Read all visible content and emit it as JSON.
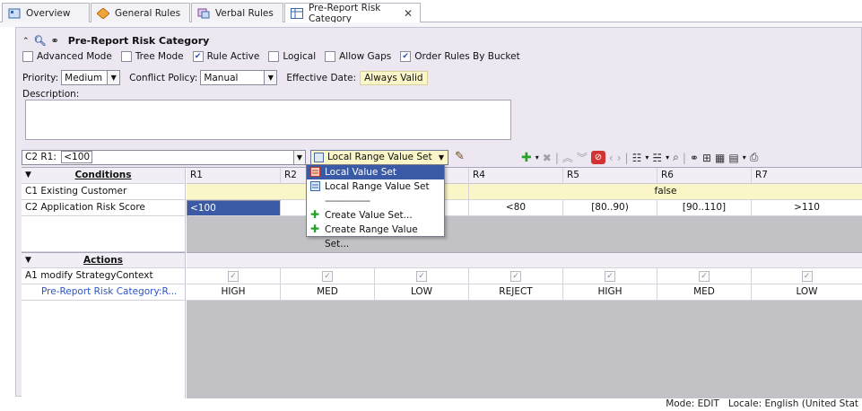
{
  "tabs": [
    {
      "label": "Overview",
      "icon": "overview-icon"
    },
    {
      "label": "General Rules",
      "icon": "rules-diamond-icon"
    },
    {
      "label": "Verbal Rules",
      "icon": "verbal-rules-icon"
    },
    {
      "label": "Pre-Report Risk Category",
      "icon": "decision-table-icon",
      "close": "✕"
    }
  ],
  "header": {
    "title": "Pre-Report Risk Category"
  },
  "options": {
    "advanced_mode": "Advanced Mode",
    "tree_mode": "Tree Mode",
    "rule_active": "Rule Active",
    "logical": "Logical",
    "allow_gaps": "Allow Gaps",
    "order_rules": "Order Rules By Bucket"
  },
  "fields": {
    "priority_label": "Priority:",
    "priority_value": "Medium",
    "conflict_label": "Conflict Policy:",
    "conflict_value": "Manual",
    "effective_label": "Effective Date:",
    "effective_value": "Always Valid",
    "description_label": "Description:"
  },
  "toolbar": {
    "cell_ref": "C2 R1:",
    "cell_value": "<100",
    "value_set_select": "Local Range Value Set"
  },
  "popup": {
    "items": [
      {
        "label": "Local Value Set"
      },
      {
        "label": "Local Range Value Set"
      },
      {
        "label": "------------------"
      },
      {
        "label": "Create Value Set..."
      },
      {
        "label": "Create Range Value Set..."
      }
    ]
  },
  "grid": {
    "conditions_header": "Conditions",
    "actions_header": "Actions",
    "columns": [
      "R1",
      "R2",
      "R3",
      "R4",
      "R5",
      "R6",
      "R7"
    ],
    "conditions": [
      {
        "label": "C1 Existing Customer",
        "merged_false": "false"
      },
      {
        "label": "C2 Application Risk Score",
        "values": [
          "<100",
          "[",
          "",
          "<80",
          "[80..90)",
          "[90..110]",
          ">110"
        ]
      }
    ],
    "actions": [
      {
        "label": "A1 modify StrategyContext"
      },
      {
        "label": "Pre-Report Risk Category:R...",
        "values": [
          "HIGH",
          "MED",
          "LOW",
          "REJECT",
          "HIGH",
          "MED",
          "LOW"
        ]
      }
    ],
    "check_glyph": "✓"
  },
  "status": {
    "mode": "Mode: EDIT",
    "locale": "Locale: English (United Stat"
  },
  "colors": {
    "pane_bg": "#ede7f2",
    "selected": "#3b5aa6",
    "yellow": "#fbf6c8",
    "gray_area": "#c2c1c5"
  }
}
